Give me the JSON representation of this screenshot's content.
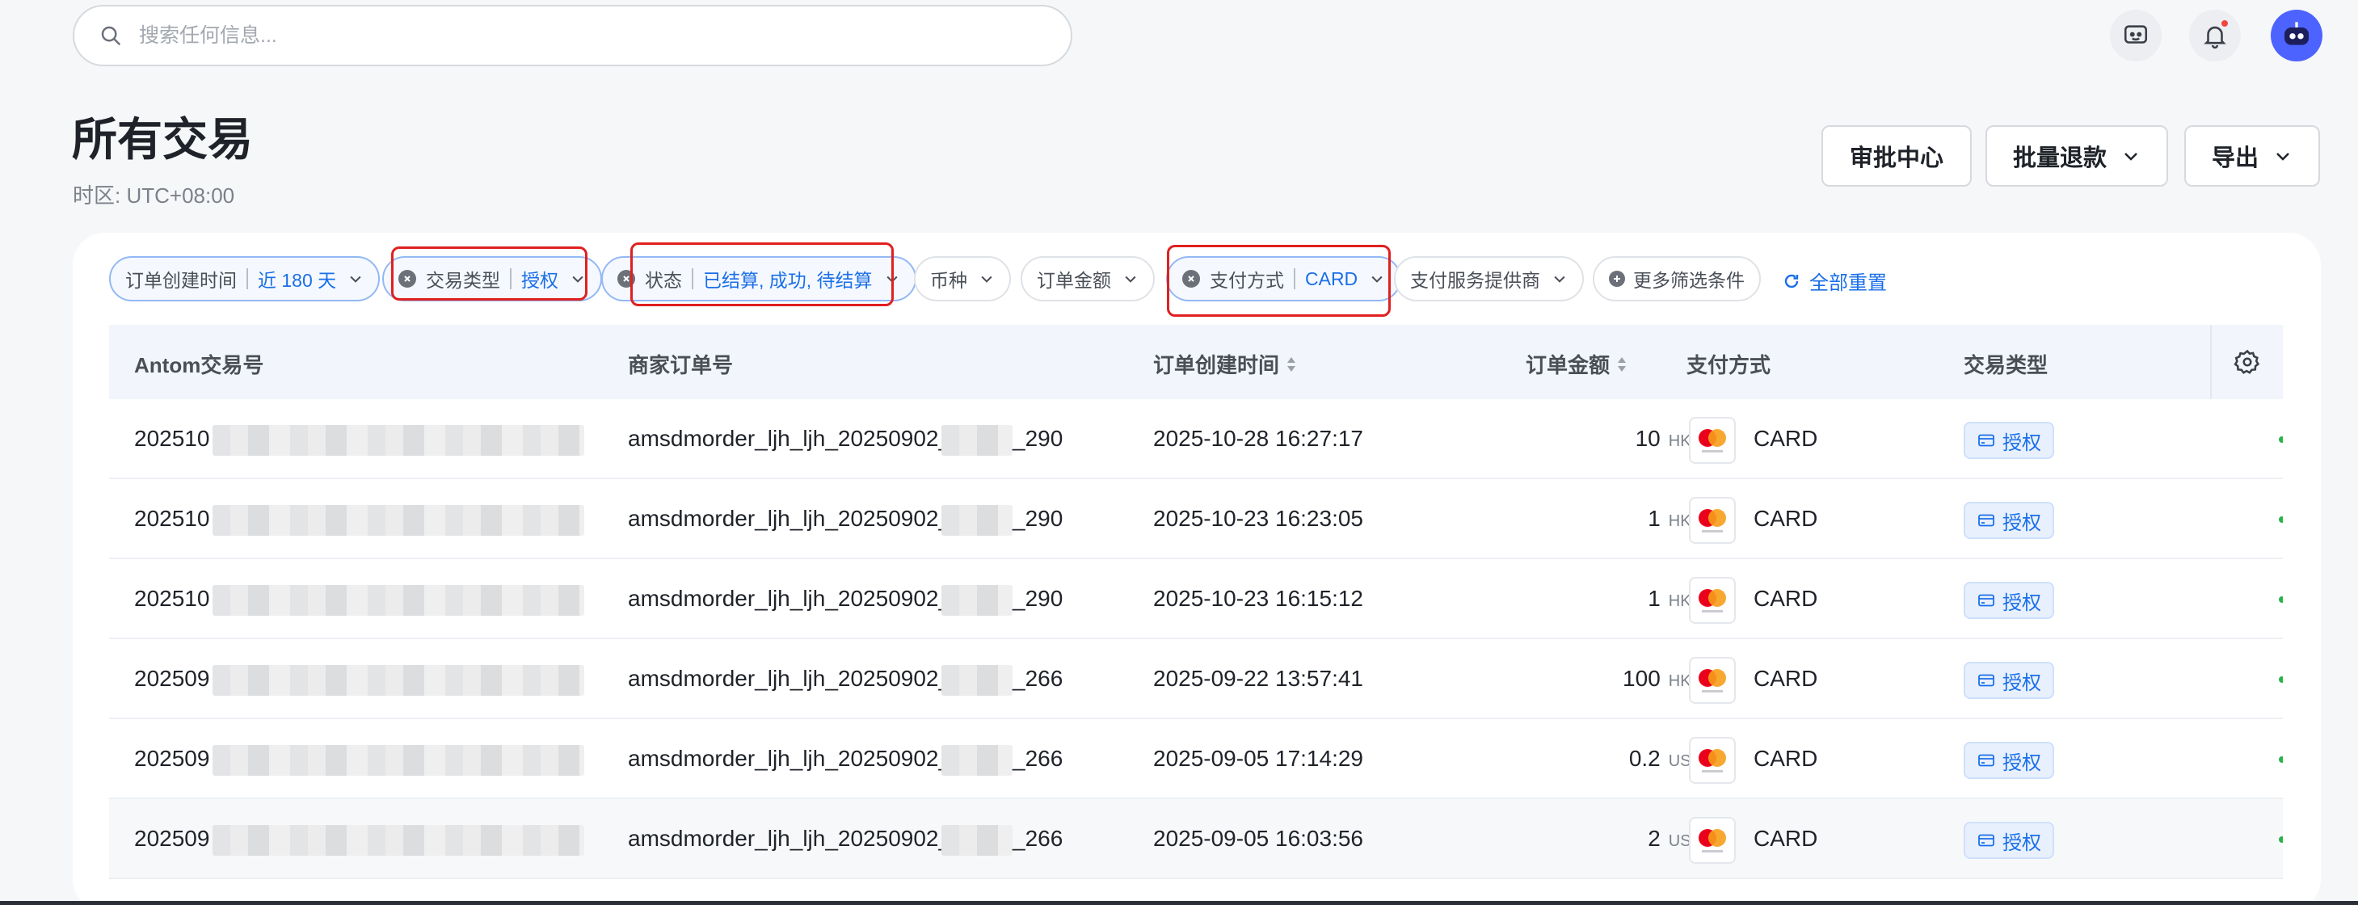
{
  "search": {
    "placeholder": "搜索任何信息..."
  },
  "header": {
    "title": "所有交易",
    "timezone": "时区: UTC+08:00"
  },
  "actions": {
    "approval": "审批中心",
    "bulk_refund": "批量退款",
    "export": "导出"
  },
  "filters": [
    {
      "label": "订单创建时间",
      "value": "近 180 天"
    },
    {
      "label": "交易类型",
      "value": "授权"
    },
    {
      "label": "状态",
      "value": "已结算, 成功, 待结算"
    },
    {
      "label": "币种",
      "value": ""
    },
    {
      "label": "订单金额",
      "value": ""
    },
    {
      "label": "支付方式",
      "value": "CARD"
    },
    {
      "label": "支付服务提供商",
      "value": ""
    },
    {
      "label": "更多筛选条件",
      "value": ""
    }
  ],
  "reset_label": "全部重置",
  "table": {
    "columns": [
      "Antom交易号",
      "商家订单号",
      "订单创建时间",
      "订单金额",
      "支付方式",
      "交易类型"
    ],
    "rows": [
      {
        "txn_prefix": "202510",
        "order_prefix": "amsdmorder_ljh_ljh_20250902_1",
        "order_suffix": "_290",
        "time": "2025-10-28 16:27:17",
        "amount": "10",
        "currency": "HKD",
        "method": "CARD",
        "type": "授权"
      },
      {
        "txn_prefix": "202510",
        "order_prefix": "amsdmorder_ljh_ljh_20250902_1",
        "order_suffix": "_290",
        "time": "2025-10-23 16:23:05",
        "amount": "1",
        "currency": "HKD",
        "method": "CARD",
        "type": "授权"
      },
      {
        "txn_prefix": "202510",
        "order_prefix": "amsdmorder_ljh_ljh_20250902_1",
        "order_suffix": "_290",
        "time": "2025-10-23 16:15:12",
        "amount": "1",
        "currency": "HKD",
        "method": "CARD",
        "type": "授权"
      },
      {
        "txn_prefix": "202509",
        "order_prefix": "amsdmorder_ljh_ljh_20250902_1",
        "order_suffix": "_266",
        "time": "2025-09-22 13:57:41",
        "amount": "100",
        "currency": "HKD",
        "method": "CARD",
        "type": "授权"
      },
      {
        "txn_prefix": "202509",
        "order_prefix": "amsdmorder_ljh_ljh_20250902_1",
        "order_suffix": "_266",
        "time": "2025-09-05 17:14:29",
        "amount": "0.2",
        "currency": "USD",
        "method": "CARD",
        "type": "授权"
      },
      {
        "txn_prefix": "202509",
        "order_prefix": "amsdmorder_ljh_ljh_20250902_1",
        "order_suffix": "_266",
        "time": "2025-09-05 16:03:56",
        "amount": "2",
        "currency": "USD",
        "method": "CARD",
        "type": "授权"
      }
    ]
  },
  "colors": {
    "accent": "#1a6fe8",
    "highlight": "#e02020",
    "success": "#2bb24c"
  },
  "icons": {
    "search": "search-icon",
    "chat": "chat-bot-icon",
    "bell": "bell-icon",
    "settings": "gear-icon",
    "reset": "refresh-icon",
    "card": "card-icon"
  }
}
